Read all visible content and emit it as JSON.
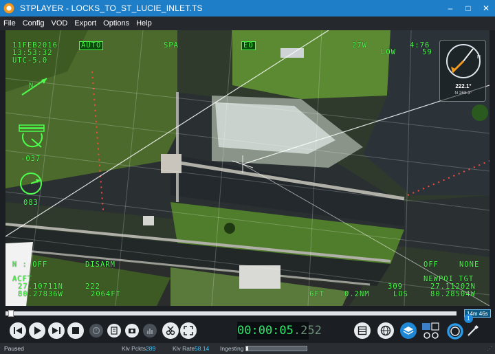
{
  "window": {
    "title": "STPLAYER - LOCKS_TO_ST_LUCIE_INLET.TS",
    "minimize": "–",
    "maximize": "□",
    "close": "✕"
  },
  "menu": [
    "File",
    "Config",
    "VOD",
    "Export",
    "Options",
    "Help"
  ],
  "hud": {
    "date": "11FEB2016",
    "time": "13:53:32",
    "utc": "UTC-5.0",
    "mode": "AUTO",
    "sensor": "SPA",
    "eo": "EO",
    "field_of_view": "27W",
    "level": "LOW",
    "zoom_top": "4:76",
    "zoom_bottom": "59",
    "north": "N",
    "elevation": "-037",
    "azimuth": "083",
    "nuc": "N : OFF",
    "laser": "DISARM",
    "acft_label": "ACFT",
    "acft_lat": "27.10711N",
    "acft_heading": "222",
    "acft_lon": "80.27836W",
    "acft_alt": "2064FT",
    "target_height": "6FT",
    "slant_range": "0.2NM",
    "los_heading": "309",
    "los_label": "LOS",
    "track_state": "OFF",
    "track_value": "NONE",
    "tgt_label": "NEWPOI TGT",
    "tgt_lat": "27.11202N",
    "tgt_lon": "80.28504W",
    "compass_heading": "222.1°",
    "compass_sub": "N 268.3°"
  },
  "timeline": {
    "duration": "14m 46s",
    "progress": 0.01
  },
  "player": {
    "timecode_main": "00:00:05",
    "timecode_ms": ".252",
    "badge_count": "1"
  },
  "status": {
    "state": "Paused",
    "klv_packets_label": "Klv Pckts",
    "klv_packets_value": "289",
    "klv_rate_label": "Klv Rate",
    "klv_rate_value": "58.14",
    "ingesting_label": "Ingesting"
  },
  "colors": {
    "hud_green": "#4dff4d",
    "title_blue": "#1e7fc8",
    "timecode_green": "#2ee86d",
    "status_value": "#3cc7ff"
  }
}
